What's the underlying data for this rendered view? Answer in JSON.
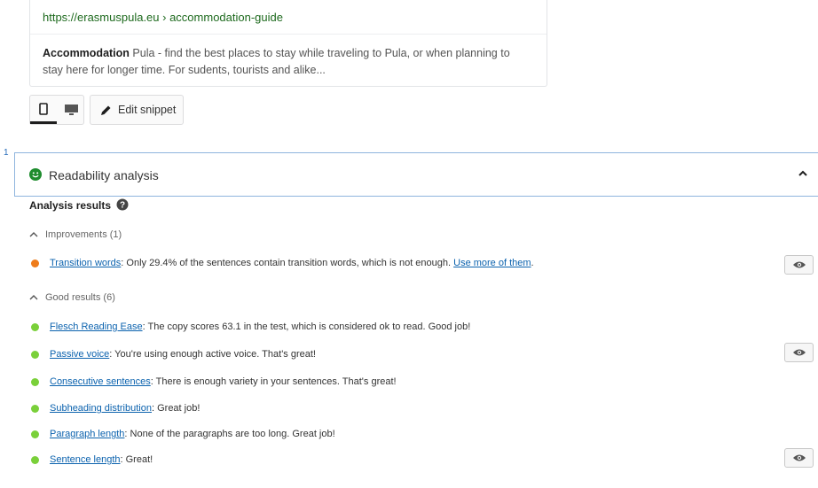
{
  "snippet": {
    "url": "https://erasmuspula.eu › accommodation-guide",
    "description_bold": "Accommodation",
    "description_text": " Pula - find the best places to stay while traveling to Pula, or when planning to stay here for longer time. For sudents, tourists and alike..."
  },
  "toolbar": {
    "mobile_icon": "mobile-icon",
    "desktop_icon": "desktop-icon",
    "edit_snippet_label": "Edit snippet"
  },
  "left_marker": "1",
  "readability": {
    "title": "Readability analysis",
    "status_color": "#1e8c2e"
  },
  "analysis": {
    "title": "Analysis results",
    "improvements": {
      "label": "Improvements (1)",
      "items": [
        {
          "link": "Transition words",
          "text": ": Only 29.4% of the sentences contain transition words, which is not enough. ",
          "link2": "Use more of them",
          "tail": "."
        }
      ]
    },
    "good": {
      "label": "Good results (6)",
      "items": [
        {
          "link": "Flesch Reading Ease",
          "text": ": The copy scores 63.1 in the test, which is considered ok to read. Good job!"
        },
        {
          "link": "Passive voice",
          "text": ": You're using enough active voice. That's great!"
        },
        {
          "link": "Consecutive sentences",
          "text": ": There is enough variety in your sentences. That's great!"
        },
        {
          "link": "Subheading distribution",
          "text": ": Great job!"
        },
        {
          "link": "Paragraph length",
          "text": ": None of the paragraphs are too long. Great job!"
        },
        {
          "link": "Sentence length",
          "text": ": Great!"
        }
      ]
    }
  },
  "colors": {
    "bullet_orange": "#ee7c1b",
    "bullet_green": "#7ad03a",
    "link": "#0b62ae",
    "header_border": "#8fb5de"
  }
}
